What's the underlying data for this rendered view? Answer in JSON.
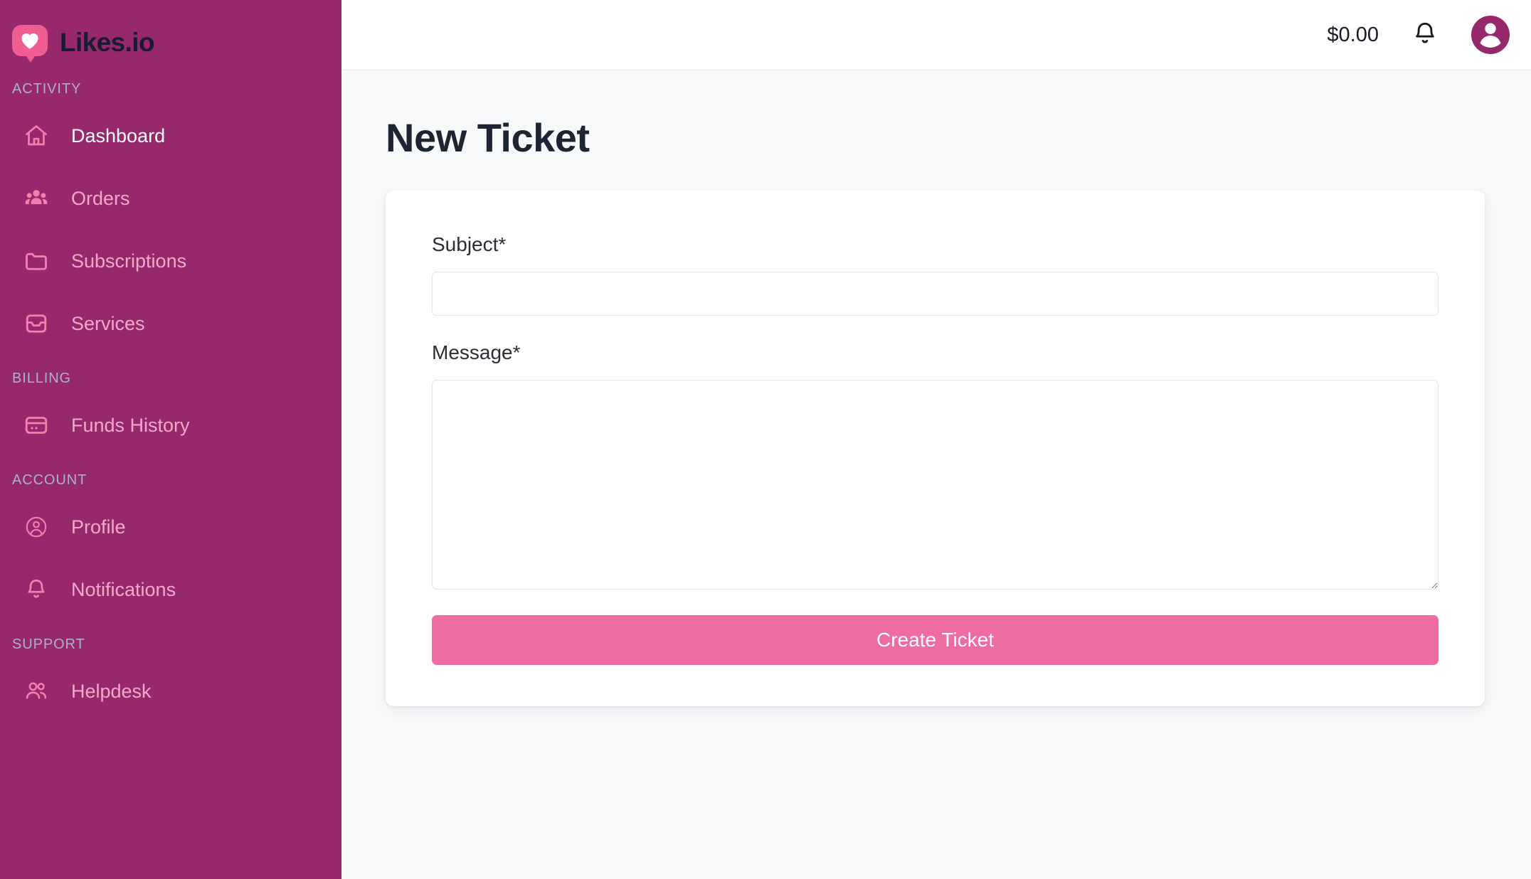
{
  "brand": {
    "name": "Likes.io",
    "logo_icon": "heart-bubble-icon"
  },
  "sidebar": {
    "sections": [
      {
        "title": "ACTIVITY",
        "items": [
          {
            "label": "Dashboard",
            "icon": "home-icon",
            "active": true
          },
          {
            "label": "Orders",
            "icon": "users-group-icon",
            "active": false
          },
          {
            "label": "Subscriptions",
            "icon": "folder-icon",
            "active": false
          },
          {
            "label": "Services",
            "icon": "inbox-icon",
            "active": false
          }
        ]
      },
      {
        "title": "BILLING",
        "items": [
          {
            "label": "Funds History",
            "icon": "credit-card-icon",
            "active": false
          }
        ]
      },
      {
        "title": "ACCOUNT",
        "items": [
          {
            "label": "Profile",
            "icon": "user-circle-icon",
            "active": false
          },
          {
            "label": "Notifications",
            "icon": "bell-icon",
            "active": false
          }
        ]
      },
      {
        "title": "SUPPORT",
        "items": [
          {
            "label": "Helpdesk",
            "icon": "users-icon",
            "active": false
          }
        ]
      }
    ]
  },
  "topbar": {
    "balance": "$0.00",
    "notifications_icon": "bell-icon",
    "avatar_icon": "user-avatar-icon"
  },
  "main": {
    "page_title": "New Ticket",
    "form": {
      "subject": {
        "label": "Subject*",
        "value": "",
        "placeholder": ""
      },
      "message": {
        "label": "Message*",
        "value": "",
        "placeholder": ""
      },
      "submit_label": "Create Ticket"
    }
  },
  "colors": {
    "sidebar_bg": "#97286c",
    "accent_pink": "#ee6ba4",
    "brand_dark": "#171c2e",
    "page_bg": "#f7f8fa"
  }
}
